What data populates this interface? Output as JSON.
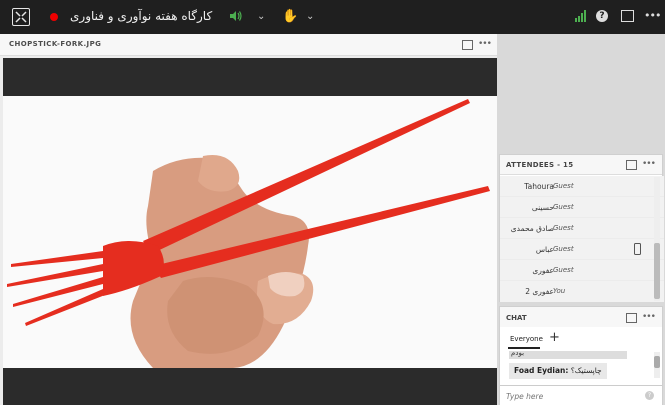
{
  "topbar": {
    "title": "کارگاه هفته نوآوری و فناوری",
    "recording_color": "#e00000",
    "signal_color": "#4caf50",
    "icons": [
      "grid-icon",
      "record-icon",
      "speaker-icon",
      "chevron-down-icon",
      "hand-icon",
      "chevron-down-icon",
      "signal-icon",
      "help-icon",
      "fullscreen-icon",
      "more-icon"
    ]
  },
  "share_pod": {
    "title": "CHOPSTICK-FORK.JPG",
    "image_description": "hand holding red chopstick fork"
  },
  "attendees": {
    "title": "ATTENDEES",
    "count": "- 15",
    "rows": [
      {
        "name": "Tahoura",
        "role": "Guest",
        "mobile": false
      },
      {
        "name": "حسینی",
        "role": "Guest",
        "mobile": false
      },
      {
        "name": "صادق محمدی",
        "role": "Guest",
        "mobile": false
      },
      {
        "name": "عباس",
        "role": "Guest",
        "mobile": true
      },
      {
        "name": "عفوری",
        "role": "Guest",
        "mobile": false
      },
      {
        "name": "عفوری 2",
        "role": "You",
        "mobile": false
      }
    ]
  },
  "chat": {
    "title": "CHAT",
    "tab": "Everyone",
    "msg_partial": "بودم",
    "msg_sender": "Foad Eydian:",
    "msg_text": "چاپستیک؟",
    "placeholder": "Type here"
  }
}
